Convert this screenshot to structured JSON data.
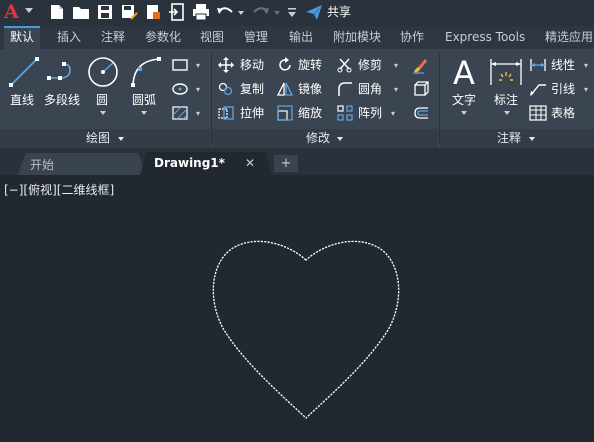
{
  "quick_access": {
    "logo_letter": "A",
    "share_label": "共享",
    "icons": [
      "new-file-icon",
      "open-folder-icon",
      "save-icon",
      "save-as-icon",
      "web-mobile-icon",
      "export-icon",
      "print-icon",
      "undo-icon",
      "redo-icon",
      "customize-icon",
      "share-icon"
    ]
  },
  "ribbon_tabs": [
    "默认",
    "插入",
    "注释",
    "参数化",
    "视图",
    "管理",
    "输出",
    "附加模块",
    "协作",
    "Express Tools",
    "精选应用"
  ],
  "active_tab": "默认",
  "draw_panel": {
    "title": "绘图",
    "line_label": "直线",
    "polyline_label": "多段线",
    "circle_label": "圆",
    "arc_label": "圆弧"
  },
  "modify_panel": {
    "title": "修改",
    "move_label": "移动",
    "rotate_label": "旋转",
    "trim_label": "修剪",
    "copy_label": "复制",
    "mirror_label": "镜像",
    "fillet_label": "圆角",
    "stretch_label": "拉伸",
    "scale_label": "缩放",
    "array_label": "阵列"
  },
  "annotation_panel": {
    "title": "注释",
    "text_label": "文字",
    "dimension_label": "标注",
    "linear_label": "线性",
    "leader_label": "引线",
    "table_label": "表格"
  },
  "file_tabs": {
    "start_label": "开始",
    "drawing_label": "Drawing1*",
    "close_glyph": "✕",
    "add_glyph": "+"
  },
  "viewport_label": "[−][俯视][二维线框]",
  "colors": {
    "logo_red": "#e8333b",
    "canvas_bg": "#212830",
    "ribbon_bg": "#3b4451",
    "accent_blue": "#4a9ad8",
    "heart_stroke": "#ffffff"
  }
}
